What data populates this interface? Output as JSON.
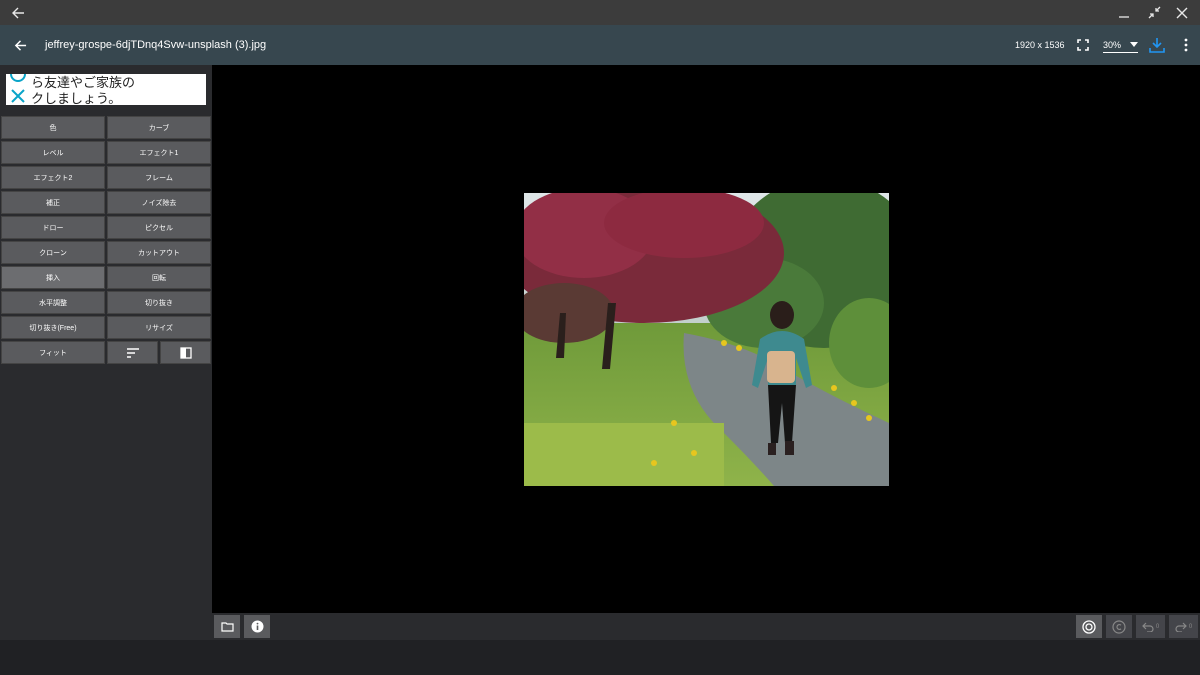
{
  "window": {
    "back_icon": "arrow-left-icon",
    "minimize_icon": "shrink-icon",
    "close_icon": "close-icon"
  },
  "app_bar": {
    "title": "jeffrey-grospe-6djTDnq4Svw-unsplash (3).jpg",
    "dimensions": "1920 x 1536",
    "zoom": "30%",
    "accent": "#2196f3"
  },
  "ad": {
    "line1": "ら友達やご家族の",
    "line2": "クしましょう。"
  },
  "tools": [
    {
      "label": "色"
    },
    {
      "label": "カーブ"
    },
    {
      "label": "レベル"
    },
    {
      "label": "エフェクト1"
    },
    {
      "label": "エフェクト2"
    },
    {
      "label": "フレーム"
    },
    {
      "label": "補正"
    },
    {
      "label": "ノイズ除去"
    },
    {
      "label": "ドロー"
    },
    {
      "label": "ピクセル"
    },
    {
      "label": "クローン"
    },
    {
      "label": "カットアウト"
    },
    {
      "label": "挿入"
    },
    {
      "label": "回転"
    },
    {
      "label": "水平調整"
    },
    {
      "label": "切り抜き"
    },
    {
      "label": "切り抜き(Free)"
    },
    {
      "label": "リサイズ"
    },
    {
      "label": "フィット"
    }
  ],
  "bottom": {
    "undo_count": "0",
    "redo_count": "0"
  }
}
